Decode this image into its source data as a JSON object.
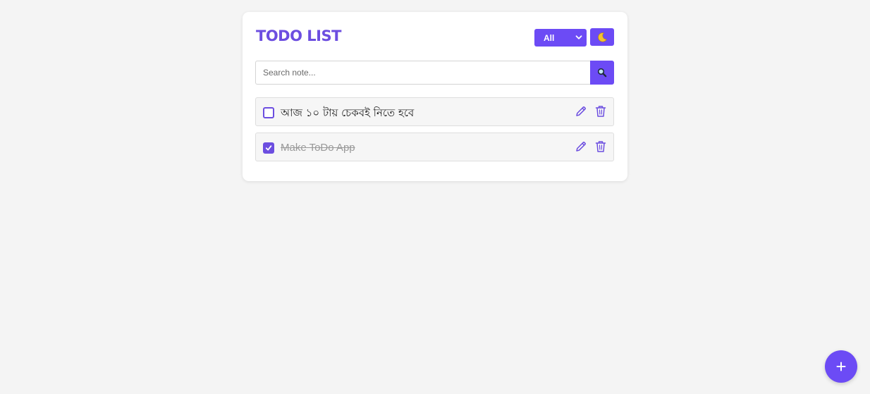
{
  "header": {
    "title": "TODO LIST"
  },
  "filter": {
    "selected": "All"
  },
  "theme_toggle": {
    "icon": "moon-icon"
  },
  "search": {
    "placeholder": "Search note...",
    "value": "",
    "icon": "magnifier-icon"
  },
  "todos": [
    {
      "text": "আজ ১০ টায় চেকবই নিতে হবে",
      "completed": false
    },
    {
      "text": "Make ToDo App",
      "completed": true
    }
  ],
  "fab": {
    "label": "+"
  },
  "colors": {
    "accent": "#6c4bf5",
    "title": "#6c4ee0",
    "background": "#f4f4f4"
  }
}
